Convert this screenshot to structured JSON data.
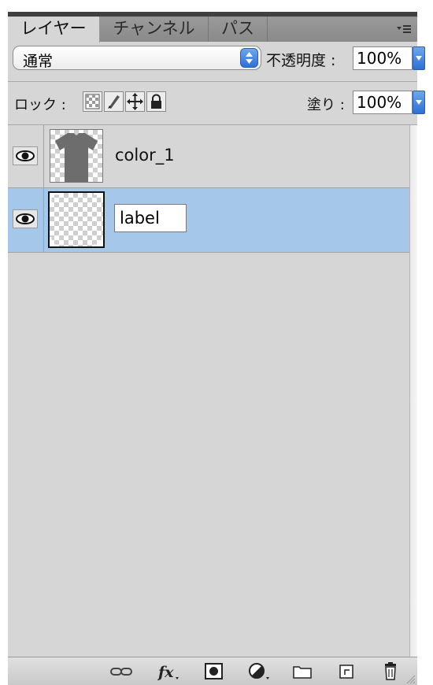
{
  "tabs": [
    {
      "label": "レイヤー",
      "active": true
    },
    {
      "label": "チャンネル",
      "active": false
    },
    {
      "label": "パス",
      "active": false
    }
  ],
  "panel_menu_icon": "panel-menu-icon",
  "blend": {
    "mode": "通常",
    "opacity_label": "不透明度 :",
    "opacity_value": "100%"
  },
  "lock": {
    "label": "ロック :",
    "icons": [
      "lock-transparent-pixels-icon",
      "lock-image-pixels-icon",
      "lock-position-icon",
      "lock-all-icon"
    ],
    "fill_label": "塗り :",
    "fill_value": "100%"
  },
  "layers": [
    {
      "name": "color_1",
      "visible": true,
      "selected": false,
      "thumbnail": "t-shirt"
    },
    {
      "name": "label",
      "visible": true,
      "selected": true,
      "editing": true,
      "thumbnail": "transparent"
    }
  ],
  "colors": {
    "panel_bg": "#d6d6d6",
    "selected_row": "#a5c7ea",
    "accent_blue": "#2d6fd6",
    "shirt": "#6d6d6d"
  },
  "bottom_toolbar": [
    "link-layers-icon",
    "layer-style-fx-icon",
    "layer-mask-icon",
    "adjustment-layer-icon",
    "new-group-icon",
    "new-layer-icon",
    "trash-icon"
  ]
}
